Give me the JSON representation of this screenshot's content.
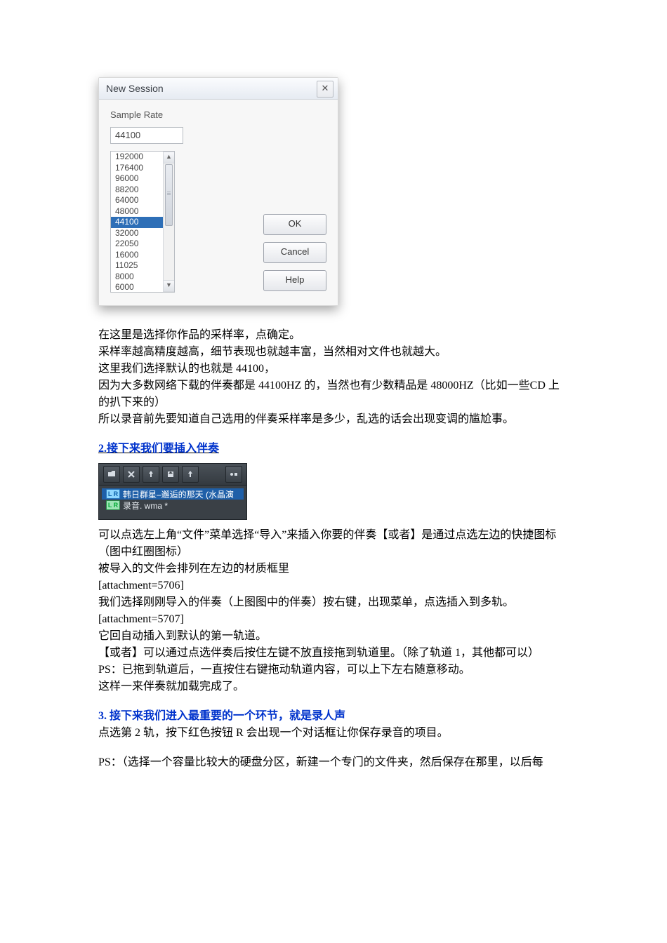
{
  "dialog": {
    "title": "New Session",
    "group_label": "Sample Rate",
    "current_value": "44100",
    "options": [
      "192000",
      "176400",
      "96000",
      "88200",
      "64000",
      "48000",
      "44100",
      "32000",
      "22050",
      "16000",
      "11025",
      "8000",
      "6000"
    ],
    "selected": "44100",
    "ok": "OK",
    "cancel": "Cancel",
    "help": "Help"
  },
  "body": {
    "a1": "在这里是选择你作品的采样率，点确定。",
    "a2": "采样率越高精度越高，细节表现也就越丰富，当然相对文件也就越大。",
    "a3": "这里我们选择默认的也就是 44100，",
    "a4": "因为大多数网络下载的伴奏都是 44100HZ 的，当然也有少数精品是 48000HZ（比如一些CD 上的扒下来的）",
    "a5": "所以录音前先要知道自己选用的伴奏采样率是多少，乱选的话会出现变调的尴尬事。",
    "h2": "2.接下来我们要插入伴奏",
    "file1": "韩日群星–邂逅的那天 (水晶演",
    "file2": "录音. wma *",
    "b1": "可以点选左上角“文件”菜单选择“导入”来插入你要的伴奏【或者】是通过点选左边的快捷图标（图中红圈图标）",
    "b2": "被导入的文件会排列在左边的材质框里",
    "b3": "[attachment=5706]",
    "b4": "我们选择刚刚导入的伴奏（上图图中的伴奏）按右键，出现菜单，点选插入到多轨。",
    "b5": "[attachment=5707]",
    "b6": "它回自动插入到默认的第一轨道。",
    "b7": "【或者】可以通过点选伴奏后按住左键不放直接拖到轨道里。（除了轨道 1，其他都可以）",
    "b8": "PS：已拖到轨道后，一直按住右键拖动轨道内容，可以上下左右随意移动。",
    "b9": "这样一来伴奏就加载完成了。",
    "h3": "3. 接下来我们进入最重要的一个环节，就是录人声",
    "c1": "点选第 2 轨，按下红色按钮 R 会出现一个对话框让你保存录音的项目。",
    "c2": "PS：（选择一个容量比较大的硬盘分区，新建一个专门的文件夹，然后保存在那里，以后每"
  }
}
